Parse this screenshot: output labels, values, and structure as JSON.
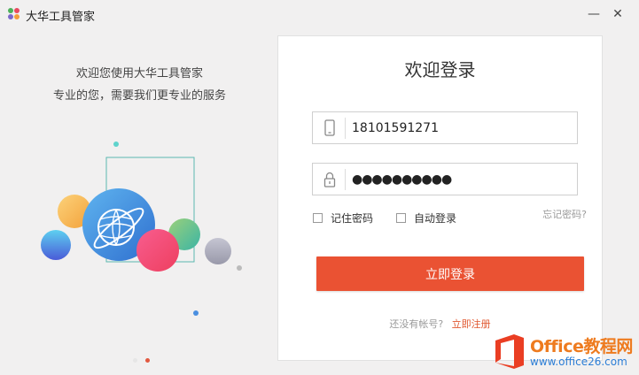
{
  "app": {
    "title": "大华工具管家",
    "logo_colors": [
      "#4cb05a",
      "#e84a5f",
      "#7b68c9",
      "#f39c3a"
    ]
  },
  "window_controls": {
    "minimize": "—",
    "close": "✕"
  },
  "promo": {
    "line1": "欢迎您使用大华工具管家",
    "line2": "专业的您，需要我们更专业的服务"
  },
  "login": {
    "title": "欢迎登录",
    "phone_value": "18101591271",
    "password_value": "●●●●●●●●●●",
    "remember_password": "记住密码",
    "auto_login": "自动登录",
    "forgot_password": "忘记密码?",
    "submit": "立即登录",
    "register_question": "还没有帐号?",
    "register_link": "立即注册",
    "accent_color": "#ea5233"
  },
  "carousel": {
    "slides": 2,
    "active": 2
  },
  "watermark": {
    "title": "Office教程网",
    "url": "www.office26.com"
  }
}
